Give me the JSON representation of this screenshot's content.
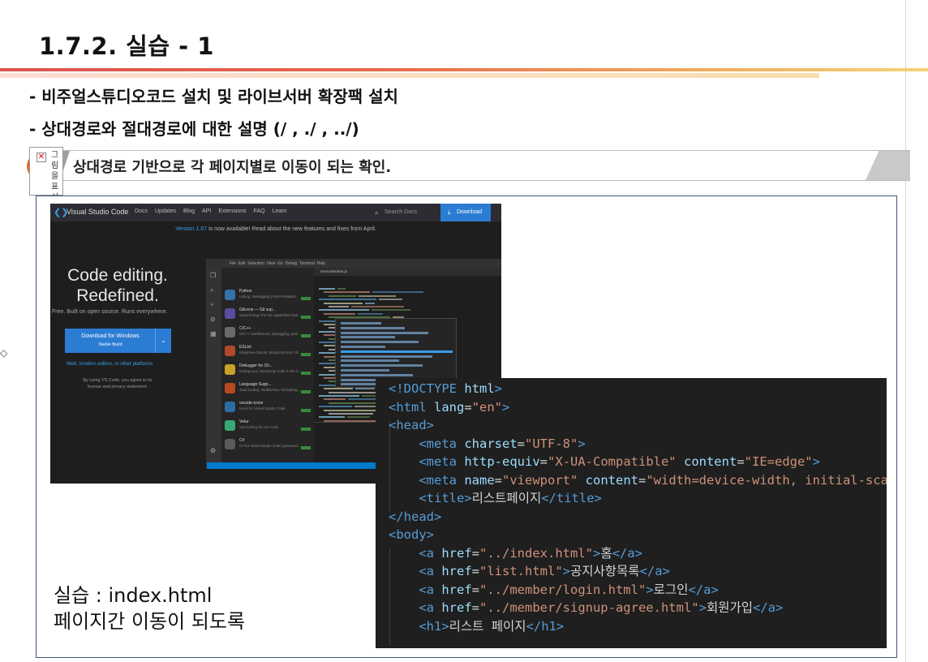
{
  "slide": {
    "title": "1.7.2. 실습 - 1",
    "bullets": [
      "- 비주얼스튜디오코드 설치 및 라이브서버 확장팩 설치",
      "- 상대경로와 절대경로에 대한 설명 (/ ,  ./  ,  ../)"
    ],
    "banner_text": "상대경로 기반으로 각 페이지별로 이동이 되는 확인.",
    "broken_image_label": "그림을표시",
    "caption_line1": "실습 : index.html",
    "caption_line2": "페이지간 이동이 되도록"
  },
  "vscode_site": {
    "brand": "Visual Studio Code",
    "nav_links": [
      "Docs",
      "Updates",
      "Blog",
      "API",
      "Extensions",
      "FAQ",
      "Learn"
    ],
    "search_placeholder": "Search Docs",
    "download_label": "Download",
    "version_link": "Version 1.67",
    "version_banner": " is now available! Read about the new features and fixes from April.",
    "headline_line1": "Code editing.",
    "headline_line2": "Redefined.",
    "subheadline": "Free. Built on open source. Runs everywhere.",
    "download_button_line1": "Download for Windows",
    "download_button_line2": "Stable Build",
    "other_platforms": "Web, Insiders edition, or other platforms",
    "agree_text": "By using VS Code, you agree to its license and privacy statement.",
    "extensions": [
      {
        "name": "Python",
        "desc": "Linting, Debugging (multi-threaded...",
        "color": "#3572a5"
      },
      {
        "name": "GitLens — Git sup...",
        "desc": "Supercharge the Git capabilities buil...",
        "color": "#5b4d9e"
      },
      {
        "name": "C/C++",
        "desc": "C/C++ IntelliSense, debugging, and...",
        "color": "#6a6a6a"
      },
      {
        "name": "ESLint",
        "desc": "Integrates ESLint JavaScript into VS...",
        "color": "#b04a2a"
      },
      {
        "name": "Debugger for Ch...",
        "desc": "Debug your JavaScript code in the C...",
        "color": "#c9a227"
      },
      {
        "name": "Language Supp...",
        "desc": "Java Linting, Intellisense, formatting,...",
        "color": "#b84a1f"
      },
      {
        "name": "vscode-icons",
        "desc": "Icons for Visual Studio Code",
        "color": "#2d6da3"
      },
      {
        "name": "Vetur",
        "desc": "Vue tooling for VS Code",
        "color": "#3aa876"
      },
      {
        "name": "C#",
        "desc": "C# for Visual Studio Code (powered...",
        "color": "#5a5a5a"
      }
    ]
  },
  "code": {
    "lines": [
      [
        [
          "tag",
          "<!DOCTYPE"
        ],
        [
          "txt",
          " "
        ],
        [
          "attr",
          "html"
        ],
        [
          "tag",
          ">"
        ]
      ],
      [
        [
          "tag",
          "<html "
        ],
        [
          "attr",
          "lang"
        ],
        [
          "txt",
          "="
        ],
        [
          "val",
          "\"en\""
        ],
        [
          "tag",
          ">"
        ]
      ],
      [
        [
          "tag",
          "<head>"
        ]
      ],
      [
        [
          "txt",
          "    "
        ],
        [
          "tag",
          "<meta "
        ],
        [
          "attr",
          "charset"
        ],
        [
          "txt",
          "="
        ],
        [
          "val",
          "\"UTF-8\""
        ],
        [
          "tag",
          ">"
        ]
      ],
      [
        [
          "txt",
          "    "
        ],
        [
          "tag",
          "<meta "
        ],
        [
          "attr",
          "http-equiv"
        ],
        [
          "txt",
          "="
        ],
        [
          "val",
          "\"X-UA-Compatible\""
        ],
        [
          "txt",
          " "
        ],
        [
          "attr",
          "content"
        ],
        [
          "txt",
          "="
        ],
        [
          "val",
          "\"IE=edge\""
        ],
        [
          "tag",
          ">"
        ]
      ],
      [
        [
          "txt",
          "    "
        ],
        [
          "tag",
          "<meta "
        ],
        [
          "attr",
          "name"
        ],
        [
          "txt",
          "="
        ],
        [
          "val",
          "\"viewport\""
        ],
        [
          "txt",
          " "
        ],
        [
          "attr",
          "content"
        ],
        [
          "txt",
          "="
        ],
        [
          "val",
          "\"width=device-width, initial-sca"
        ]
      ],
      [
        [
          "txt",
          "    "
        ],
        [
          "tag",
          "<title>"
        ],
        [
          "txt",
          "리스트페이지"
        ],
        [
          "tag",
          "</title>"
        ]
      ],
      [
        [
          "tag",
          "</head>"
        ]
      ],
      [
        [
          "tag",
          "<body>"
        ]
      ],
      [
        [
          "txt",
          "    "
        ],
        [
          "tag",
          "<a "
        ],
        [
          "attr",
          "href"
        ],
        [
          "txt",
          "="
        ],
        [
          "val",
          "\"../index.html\""
        ],
        [
          "tag",
          ">"
        ],
        [
          "txt",
          "홈"
        ],
        [
          "tag",
          "</a>"
        ]
      ],
      [
        [
          "txt",
          "    "
        ],
        [
          "tag",
          "<a "
        ],
        [
          "attr",
          "href"
        ],
        [
          "txt",
          "="
        ],
        [
          "val",
          "\"list.html\""
        ],
        [
          "tag",
          ">"
        ],
        [
          "txt",
          "공지사항목록"
        ],
        [
          "tag",
          "</a>"
        ]
      ],
      [
        [
          "txt",
          "    "
        ],
        [
          "tag",
          "<a "
        ],
        [
          "attr",
          "href"
        ],
        [
          "txt",
          "="
        ],
        [
          "val",
          "\"../member/login.html\""
        ],
        [
          "tag",
          ">"
        ],
        [
          "txt",
          "로그인"
        ],
        [
          "tag",
          "</a>"
        ]
      ],
      [
        [
          "txt",
          "    "
        ],
        [
          "tag",
          "<a "
        ],
        [
          "attr",
          "href"
        ],
        [
          "txt",
          "="
        ],
        [
          "val",
          "\"../member/signup-agree.html\""
        ],
        [
          "tag",
          ">"
        ],
        [
          "txt",
          "회원가입"
        ],
        [
          "tag",
          "</a>"
        ]
      ],
      [
        [
          "txt",
          "    "
        ],
        [
          "tag",
          "<h1>"
        ],
        [
          "txt",
          "리스트 페이지"
        ],
        [
          "tag",
          "</h1>"
        ]
      ]
    ]
  },
  "colors": {
    "accent_orange": "#e8642a",
    "code_bg": "#1f1f1f",
    "vscode_blue": "#2b7cd3"
  }
}
